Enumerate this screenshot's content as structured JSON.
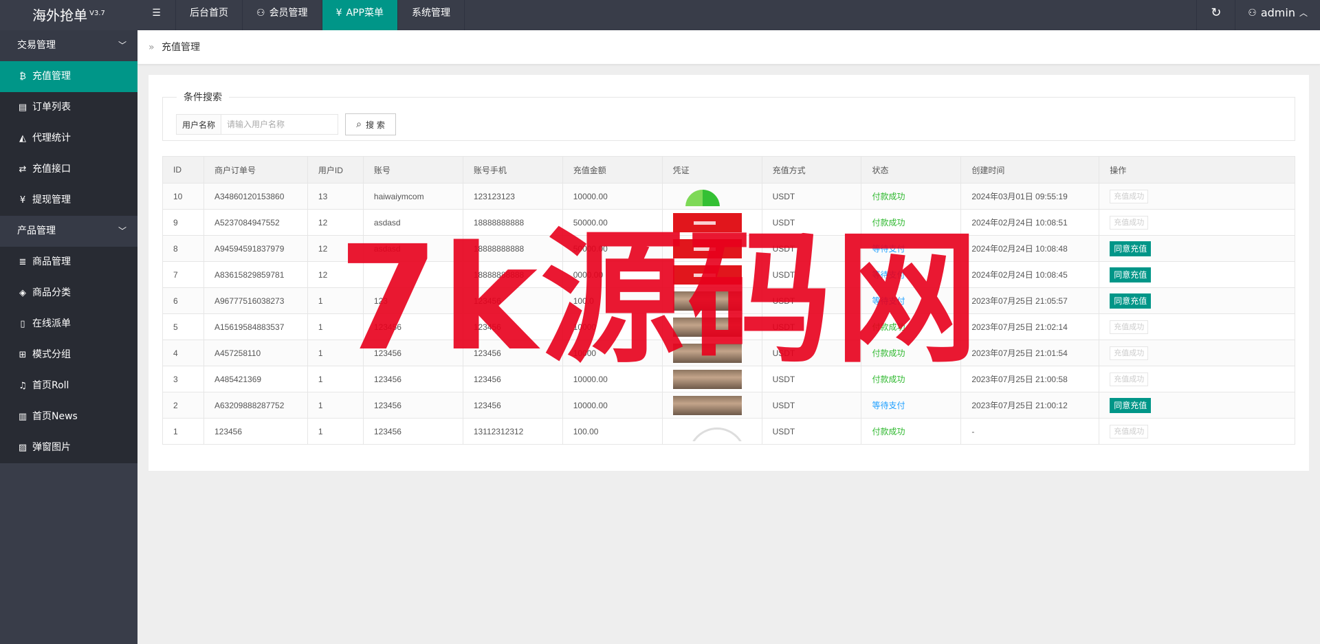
{
  "app": {
    "title": "海外抢单",
    "version": "V3.7"
  },
  "topnav": {
    "items": [
      {
        "label": "后台首页",
        "icon": ""
      },
      {
        "label": "会员管理",
        "icon": "user-icon"
      },
      {
        "label": "APP菜单",
        "icon": "yen-icon"
      },
      {
        "label": "系统管理",
        "icon": ""
      }
    ],
    "active": "APP菜单",
    "user": "admin"
  },
  "sidebar": {
    "groups": [
      {
        "label": "交易管理",
        "items": [
          {
            "label": "充值管理",
            "icon": "bitcoin-icon"
          },
          {
            "label": "订单列表",
            "icon": "list-icon"
          },
          {
            "label": "代理统计",
            "icon": "chart-icon"
          },
          {
            "label": "充值接口",
            "icon": "exchange-icon"
          },
          {
            "label": "提现管理",
            "icon": "yen-icon"
          }
        ]
      },
      {
        "label": "产品管理",
        "items": [
          {
            "label": "商品管理",
            "icon": "lines-icon"
          },
          {
            "label": "商品分类",
            "icon": "layers-icon"
          },
          {
            "label": "在线派单",
            "icon": "note-icon"
          },
          {
            "label": "模式分组",
            "icon": "sitemap-icon"
          },
          {
            "label": "首页Roll",
            "icon": "bell-icon"
          },
          {
            "label": "首页News",
            "icon": "news-icon"
          },
          {
            "label": "弹窗图片",
            "icon": "image-icon"
          }
        ]
      }
    ],
    "active": "充值管理"
  },
  "breadcrumb": {
    "separator": "»",
    "current": "充值管理"
  },
  "search": {
    "legend": "条件搜索",
    "label": "用户名称",
    "placeholder": "请输入用户名称",
    "value": "",
    "button": "搜 索"
  },
  "table": {
    "columns": [
      "ID",
      "商户订单号",
      "用户ID",
      "账号",
      "账号手机",
      "充值金额",
      "凭证",
      "充值方式",
      "状态",
      "创建时间",
      "操作"
    ],
    "rows": [
      {
        "id": "10",
        "order": "A34860120153860",
        "uid": "13",
        "account": "haiwaiymcom",
        "phone": "123123123",
        "amount": "10000.00",
        "voucher": "green",
        "method": "USDT",
        "status": "付款成功",
        "status_type": "ok",
        "time": "2024年03月01日 09:55:19",
        "action": "充值成功",
        "action_type": "disabled"
      },
      {
        "id": "9",
        "order": "A5237084947552",
        "uid": "12",
        "account": "asdasd",
        "phone": "18888888888",
        "amount": "50000.00",
        "voucher": "red",
        "method": "USDT",
        "status": "付款成功",
        "status_type": "ok",
        "time": "2024年02月24日 10:08:51",
        "action": "充值成功",
        "action_type": "disabled"
      },
      {
        "id": "8",
        "order": "A94594591837979",
        "uid": "12",
        "account": "asdasd",
        "phone": "18888888888",
        "amount": "50000.00",
        "voucher": "red",
        "method": "USDT",
        "status": "等待支付",
        "status_type": "wait",
        "time": "2024年02月24日 10:08:48",
        "action": "同意充值",
        "action_type": "approve"
      },
      {
        "id": "7",
        "order": "A83615829859781",
        "uid": "12",
        "account": "",
        "phone": "18888888888",
        "amount": "0000.00",
        "voucher": "red",
        "method": "USDT",
        "status": "等待支付",
        "status_type": "wait",
        "time": "2024年02月24日 10:08:45",
        "action": "同意充值",
        "action_type": "approve"
      },
      {
        "id": "6",
        "order": "A96777516038273",
        "uid": "1",
        "account": "123",
        "phone": "123456",
        "amount": "100.0",
        "voucher": "photo",
        "method": "USDT",
        "status": "等待支付",
        "status_type": "wait",
        "time": "2023年07月25日 21:05:57",
        "action": "同意充值",
        "action_type": "approve"
      },
      {
        "id": "5",
        "order": "A15619584883537",
        "uid": "1",
        "account": "123456",
        "phone": "123456",
        "amount": "10000",
        "voucher": "photo",
        "method": "USDT",
        "status": "付款成功",
        "status_type": "ok",
        "time": "2023年07月25日 21:02:14",
        "action": "充值成功",
        "action_type": "disabled"
      },
      {
        "id": "4",
        "order": "A457258110",
        "uid": "1",
        "account": "123456",
        "phone": "123456",
        "amount": "10000",
        "voucher": "photo",
        "method": "USDT",
        "status": "付款成功",
        "status_type": "ok",
        "time": "2023年07月25日 21:01:54",
        "action": "充值成功",
        "action_type": "disabled"
      },
      {
        "id": "3",
        "order": "A485421369",
        "uid": "1",
        "account": "123456",
        "phone": "123456",
        "amount": "10000.00",
        "voucher": "photo",
        "method": "USDT",
        "status": "付款成功",
        "status_type": "ok",
        "time": "2023年07月25日 21:00:58",
        "action": "充值成功",
        "action_type": "disabled"
      },
      {
        "id": "2",
        "order": "A63209888287752",
        "uid": "1",
        "account": "123456",
        "phone": "123456",
        "amount": "10000.00",
        "voucher": "photo",
        "method": "USDT",
        "status": "等待支付",
        "status_type": "wait",
        "time": "2023年07月25日 21:00:12",
        "action": "同意充值",
        "action_type": "approve"
      },
      {
        "id": "1",
        "order": "123456",
        "uid": "1",
        "account": "123456",
        "phone": "13112312312",
        "amount": "100.00",
        "voucher": "arc",
        "method": "USDT",
        "status": "付款成功",
        "status_type": "ok",
        "time": "-",
        "action": "充值成功",
        "action_type": "disabled"
      }
    ]
  },
  "watermark": "7k源码网",
  "colors": {
    "accent": "#009688",
    "topbar": "#393d49",
    "ok": "#2eb82e",
    "wait": "#1e9fff",
    "watermark": "#e8001c"
  }
}
